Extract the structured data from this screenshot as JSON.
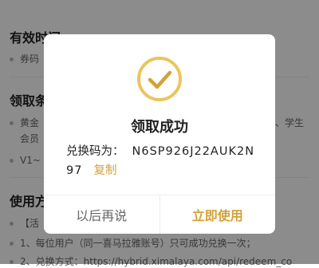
{
  "background": {
    "validity_title": "有效时间",
    "validity_item": "券码",
    "claim_title": "领取条件",
    "claim_item1_start": "黄金",
    "claim_item1_end": "、学生",
    "claim_item1_line2": "会员",
    "claim_item2": "V1~",
    "usage_title": "使用方式",
    "usage_item0": "【活",
    "usage_item1": "1、每位用户（同一喜马拉雅账号）只可成功兑换一次；",
    "usage_item2": "2、兑换方式：https://hybrid.ximalaya.com/api/redeem_co"
  },
  "modal": {
    "title": "领取成功",
    "code_label": "兑换码为：",
    "code_value": "N6SP926J22AUK2N97",
    "copy_label": "复制",
    "later_button": "以后再说",
    "use_button": "立即使用",
    "accent_color": "#d3a13a",
    "icon": "check-circle-icon"
  }
}
